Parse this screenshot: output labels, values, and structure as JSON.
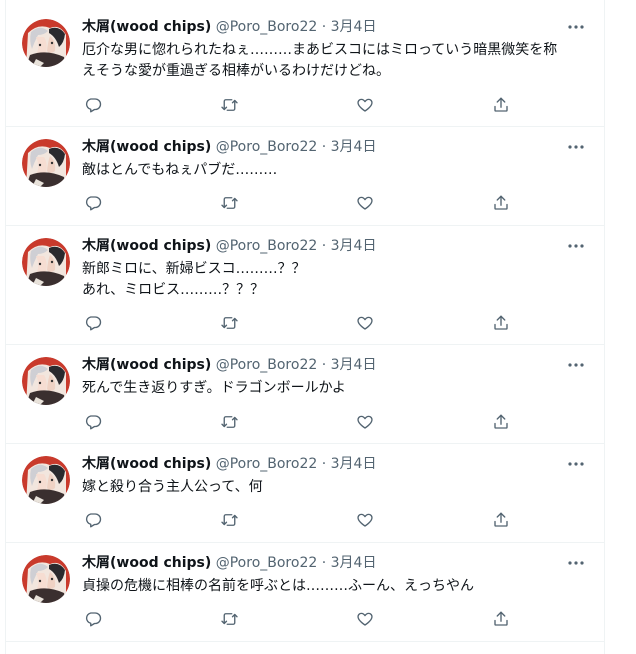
{
  "author": {
    "name": "木屑(wood chips)",
    "handle": "@Poro_Boro22"
  },
  "colors": {
    "text": "#0f1419",
    "secondary": "#536471",
    "divider": "#eff3f4",
    "avatar_red": "#c93a2c"
  },
  "icons": {
    "more": "more-icon",
    "reply": "reply-icon",
    "retweet": "retweet-icon",
    "like": "like-icon",
    "share": "share-icon"
  },
  "tweets": [
    {
      "date": "3月4日",
      "lines": [
        "厄介な男に惚れられたねぇ………まあビスコにはミロっていう暗黒微笑を称",
        "えそうな愛が重過ぎる相棒がいるわけだけどね。"
      ]
    },
    {
      "date": "3月4日",
      "lines": [
        "敵はとんでもねぇパブだ………"
      ]
    },
    {
      "date": "3月4日",
      "lines": [
        "新郎ミロに、新婦ビスコ………？？",
        "あれ、ミロビス………？？？"
      ]
    },
    {
      "date": "3月4日",
      "lines": [
        "死んで生き返りすぎ。ドラゴンボールかよ"
      ]
    },
    {
      "date": "3月4日",
      "lines": [
        "嫁と殺り合う主人公って、何"
      ]
    },
    {
      "date": "3月4日",
      "lines": [
        "貞操の危機に相棒の名前を呼ぶとは………ふーん、えっちやん"
      ]
    }
  ]
}
